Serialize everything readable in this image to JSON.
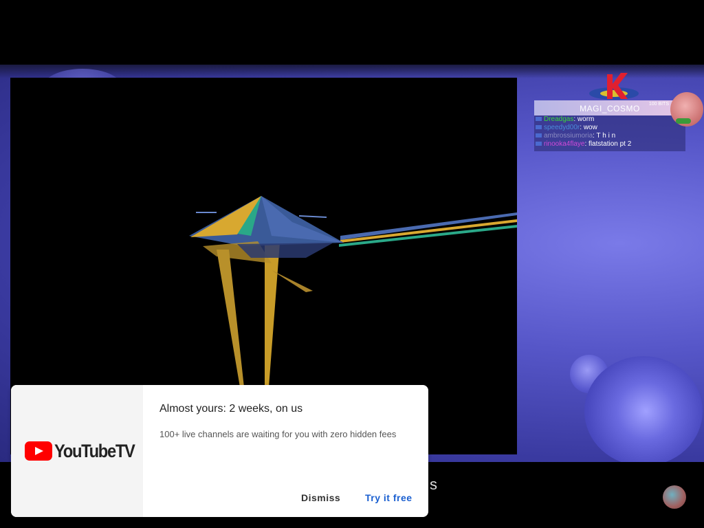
{
  "stream": {
    "chat": {
      "highlight": {
        "username": "MAGI_COSMO",
        "amount": "100 BITS"
      },
      "messages": [
        {
          "user": "Dreadgas",
          "text": ": worm",
          "color": "#3ad83a"
        },
        {
          "user": "speedyd00r",
          "text": ": wow",
          "color": "#4a8ad8"
        },
        {
          "user": "ambrossiumoria",
          "text": ": T h i n",
          "color": "#8a8ac0"
        },
        {
          "user": "rinooka4flaye",
          "text": ": flatstation pt 2",
          "color": "#d04ad8"
        }
      ]
    },
    "caption_fragment": "s"
  },
  "toast": {
    "brand": "YouTubeTV",
    "title": "Almost yours: 2 weeks, on us",
    "body": "100+ live channels are waiting for you with zero hidden fees",
    "dismiss_label": "Dismiss",
    "try_label": "Try it free",
    "colors": {
      "brand_red": "#ff0000",
      "accent_blue": "#1a5fd0"
    }
  }
}
